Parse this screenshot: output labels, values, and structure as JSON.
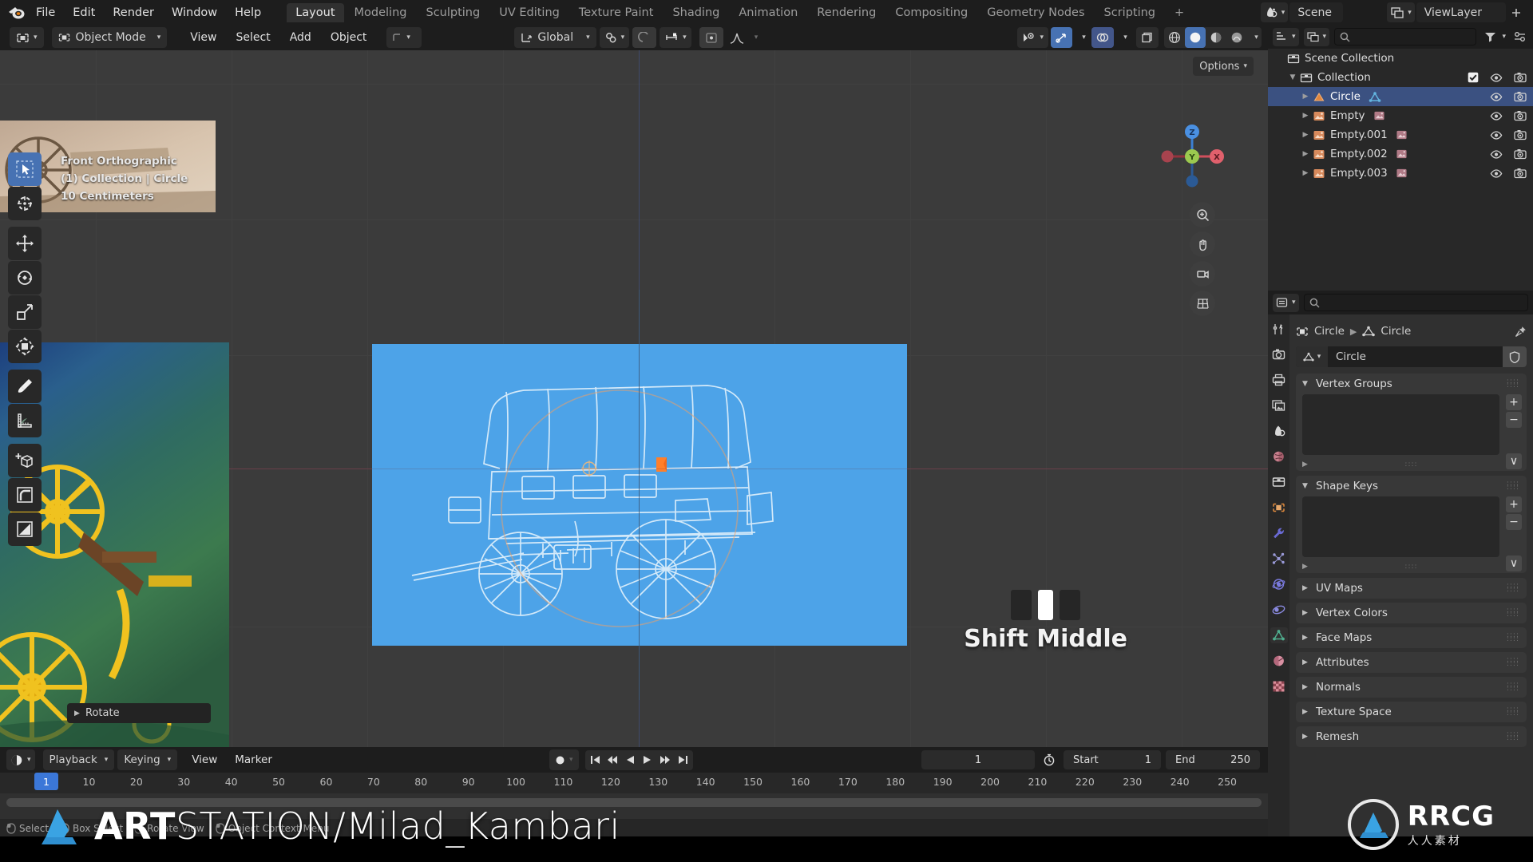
{
  "app": {
    "logo_icon": "blender-logo"
  },
  "menubar": {
    "menus": [
      "File",
      "Edit",
      "Render",
      "Window",
      "Help"
    ],
    "workspaces": [
      {
        "label": "Layout",
        "active": true
      },
      {
        "label": "Modeling",
        "active": false
      },
      {
        "label": "Sculpting",
        "active": false
      },
      {
        "label": "UV Editing",
        "active": false
      },
      {
        "label": "Texture Paint",
        "active": false
      },
      {
        "label": "Shading",
        "active": false
      },
      {
        "label": "Animation",
        "active": false
      },
      {
        "label": "Rendering",
        "active": false
      },
      {
        "label": "Compositing",
        "active": false
      },
      {
        "label": "Geometry Nodes",
        "active": false
      },
      {
        "label": "Scripting",
        "active": false
      }
    ],
    "add_workspace_label": "+",
    "scene": {
      "icon": "scene-icon",
      "name": "Scene"
    },
    "viewlayer": {
      "icon": "viewlayer-icon",
      "name": "ViewLayer"
    }
  },
  "viewport_header": {
    "editor_type_icon": "editor-type-3dview-icon",
    "mode": "Object Mode",
    "menus": [
      "View",
      "Select",
      "Add",
      "Object"
    ],
    "transform_orientation": "Global",
    "snap_icon": "magnet-icon",
    "proportional_icon": "proportional-edit-icon",
    "falloff_icon": "smooth-falloff-icon",
    "pivot_icon": "pivot-point-icon",
    "mirror_icon": "mirror-icon",
    "right_icons": [
      "visibility-icon",
      "gizmo-icon",
      "overlays-icon",
      "xray-icon",
      "shading-wireframe-icon",
      "shading-solid-icon",
      "shading-material-icon",
      "shading-rendered-icon"
    ]
  },
  "viewport": {
    "options_label": "Options",
    "info_lines": [
      "Front Orthographic",
      "(1) Collection | Circle",
      "10 Centimeters"
    ],
    "gizmo_axes": [
      {
        "label": "Z",
        "color": "#3b7fd4"
      },
      {
        "label": "Y",
        "color": "#8bc24a"
      },
      {
        "label": "X",
        "color": "#d04f5c"
      }
    ],
    "nav_icons": [
      "zoom-icon",
      "hand-icon",
      "camera-icon",
      "grid-icon"
    ],
    "operator_panel": {
      "label": "Rotate",
      "expand_icon": "chevron-right-icon"
    },
    "hint": {
      "text": "Shift Middle",
      "keys": [
        "left",
        "middle",
        "right"
      ],
      "active_key": "middle"
    },
    "plane_color": "#4da3e8",
    "toolbar_tools": [
      {
        "name": "tweak-select-box-tool",
        "icon": "cursor-arrow-icon",
        "active": true
      },
      {
        "name": "cursor-tool",
        "icon": "3d-cursor-icon",
        "active": false
      },
      {
        "name": "move-tool",
        "icon": "move-arrows-icon",
        "active": false
      },
      {
        "name": "rotate-tool",
        "icon": "rotate-icon",
        "active": false
      },
      {
        "name": "scale-tool",
        "icon": "scale-icon",
        "active": false
      },
      {
        "name": "transform-tool",
        "icon": "transform-icon",
        "active": false
      },
      {
        "name": "annotate-tool",
        "icon": "pencil-icon",
        "active": false
      },
      {
        "name": "measure-tool",
        "icon": "ruler-icon",
        "active": false
      },
      {
        "name": "add-cube-tool",
        "icon": "add-cube-icon",
        "active": false
      },
      {
        "name": "bevel-tool",
        "icon": "bevel-icon",
        "active": false
      },
      {
        "name": "shear-tool",
        "icon": "shear-icon",
        "active": false
      }
    ]
  },
  "outliner": {
    "editor_icon": "outliner-icon",
    "display_mode_icon": "view-layer-icon",
    "search_placeholder": "",
    "filter_icon": "filter-icon",
    "rows": [
      {
        "indent": 0,
        "disclosure": "",
        "icon": "collection-icon",
        "name": "Scene Collection",
        "selected": false,
        "checkbox": false,
        "eye": false,
        "camera": false
      },
      {
        "indent": 1,
        "disclosure": "open",
        "icon": "collection-icon",
        "name": "Collection",
        "selected": false,
        "checkbox": true,
        "eye": true,
        "camera": true
      },
      {
        "indent": 2,
        "disclosure": "closed",
        "icon": "mesh-data-icon",
        "name": "Circle",
        "data_icon": "mesh-triangle-icon",
        "selected": true,
        "checkbox": false,
        "eye": true,
        "camera": true
      },
      {
        "indent": 2,
        "disclosure": "closed",
        "icon": "empty-image-icon",
        "name": "Empty",
        "data_icon": "image-icon",
        "selected": false,
        "checkbox": false,
        "eye": true,
        "camera": true
      },
      {
        "indent": 2,
        "disclosure": "closed",
        "icon": "empty-image-icon",
        "name": "Empty.001",
        "data_icon": "image-icon",
        "selected": false,
        "checkbox": false,
        "eye": true,
        "camera": true
      },
      {
        "indent": 2,
        "disclosure": "closed",
        "icon": "empty-image-icon",
        "name": "Empty.002",
        "data_icon": "image-icon",
        "selected": false,
        "checkbox": false,
        "eye": true,
        "camera": true
      },
      {
        "indent": 2,
        "disclosure": "closed",
        "icon": "empty-image-icon",
        "name": "Empty.003",
        "data_icon": "image-icon",
        "selected": false,
        "checkbox": false,
        "eye": true,
        "camera": true
      }
    ]
  },
  "properties": {
    "editor_icon": "properties-icon",
    "search_placeholder": "",
    "tabs": [
      {
        "name": "tool-tab",
        "icon": "tool-icon",
        "active": false
      },
      {
        "name": "render-tab",
        "icon": "camera-back-icon",
        "active": false
      },
      {
        "name": "output-tab",
        "icon": "printer-icon",
        "active": false
      },
      {
        "name": "view-layer-tab",
        "icon": "images-icon",
        "active": false
      },
      {
        "name": "scene-tab",
        "icon": "scene-cone-icon",
        "active": false
      },
      {
        "name": "world-tab",
        "icon": "world-icon",
        "active": false
      },
      {
        "name": "collection-tab",
        "icon": "collection-box-icon",
        "active": false
      },
      {
        "name": "object-tab",
        "icon": "object-square-icon",
        "active": false
      },
      {
        "name": "modifier-tab",
        "icon": "wrench-icon",
        "active": false
      },
      {
        "name": "particles-tab",
        "icon": "particles-icon",
        "active": false
      },
      {
        "name": "physics-tab",
        "icon": "physics-orbit-icon",
        "active": false
      },
      {
        "name": "constraints-tab",
        "icon": "constraint-icon",
        "active": false
      },
      {
        "name": "data-tab",
        "icon": "mesh-data-green-icon",
        "active": true
      },
      {
        "name": "material-tab",
        "icon": "material-sphere-icon",
        "active": false
      },
      {
        "name": "texture-tab",
        "icon": "texture-checker-icon",
        "active": false
      }
    ],
    "breadcrumb": [
      {
        "icon": "object-square-icon",
        "label": "Circle"
      },
      {
        "icon": "chevron-right-icon",
        "label": ""
      },
      {
        "icon": "mesh-data-icon",
        "label": "Circle"
      }
    ],
    "pin_icon": "pin-icon",
    "name_field": {
      "icon": "mesh-data-icon",
      "value": "Circle",
      "shield_icon": "shield-icon"
    },
    "panels": [
      {
        "label": "Vertex Groups",
        "open": true,
        "has_list": true,
        "side_buttons": [
          "+",
          "−",
          "∨"
        ]
      },
      {
        "label": "Shape Keys",
        "open": true,
        "has_list": true,
        "side_buttons": [
          "+",
          "−",
          "∨"
        ]
      },
      {
        "label": "UV Maps",
        "open": false,
        "has_list": false
      },
      {
        "label": "Vertex Colors",
        "open": false,
        "has_list": false
      },
      {
        "label": "Face Maps",
        "open": false,
        "has_list": false
      },
      {
        "label": "Attributes",
        "open": false,
        "has_list": false
      },
      {
        "label": "Normals",
        "open": false,
        "has_list": false
      },
      {
        "label": "Texture Space",
        "open": false,
        "has_list": false
      },
      {
        "label": "Remesh",
        "open": false,
        "has_list": false
      }
    ]
  },
  "timeline": {
    "editor_icon": "timeline-icon",
    "menus": [
      "Playback",
      "Keying",
      "View",
      "Marker"
    ],
    "record_icon": "record-keyframes-icon",
    "playback_buttons": [
      "jump-start-icon",
      "prev-keyframe-icon",
      "play-reverse-icon",
      "play-icon",
      "next-keyframe-icon",
      "jump-end-icon"
    ],
    "current_frame": "1",
    "auto_key_icon": "stopwatch-icon",
    "start_label": "Start",
    "start_value": "1",
    "end_label": "End",
    "end_value": "250",
    "ruler_ticks": [
      "1",
      "10",
      "20",
      "30",
      "40",
      "50",
      "60",
      "70",
      "80",
      "90",
      "100",
      "110",
      "120",
      "130",
      "140",
      "150",
      "160",
      "170",
      "180",
      "190",
      "200",
      "210",
      "220",
      "230",
      "240",
      "250"
    ],
    "playhead_frame": "1",
    "status_items": [
      {
        "icon": "mouse-left-icon",
        "label": "Select"
      },
      {
        "icon": "mouse-right-icon",
        "label": "Box Select"
      },
      {
        "icon": "mouse-middle-icon",
        "label": "Rotate View"
      },
      {
        "icon": "key-ctrl-icon",
        "label": "Object Context Menu"
      }
    ]
  },
  "watermarks": {
    "artstation": {
      "bold": "ART",
      "light": "STATION/Milad_Kambari",
      "logo_icon": "artstation-logo"
    },
    "rrcg": {
      "logo_icon": "rrcg-logo",
      "text": "RRCG",
      "subtext": "人人素材"
    }
  },
  "colors": {
    "accent_blue": "#4772b3",
    "selection_blue": "#3b5181",
    "plane_blue": "#4da3e8",
    "axis_x": "#6a3f4a",
    "axis_z": "#3f4a6a"
  }
}
